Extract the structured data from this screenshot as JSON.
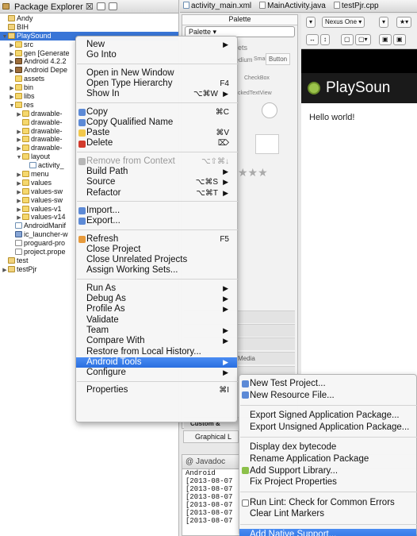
{
  "explorer": {
    "tab_title": "Package Explorer ☒",
    "tree": [
      {
        "label": "Andy",
        "icon": "project-icon",
        "depth": 0,
        "twisty": ""
      },
      {
        "label": "BIH",
        "icon": "project-icon",
        "depth": 0,
        "twisty": ""
      },
      {
        "label": "PlaySound",
        "icon": "project-icon",
        "depth": 0,
        "twisty": "▼"
      },
      {
        "label": "src",
        "icon": "folder-icon",
        "depth": 1,
        "twisty": "▶"
      },
      {
        "label": "gen [Generate",
        "icon": "folder-icon",
        "depth": 1,
        "twisty": "▶"
      },
      {
        "label": "Android 4.2.2",
        "icon": "library-icon",
        "depth": 1,
        "twisty": "▶"
      },
      {
        "label": "Android Depe",
        "icon": "library-icon",
        "depth": 1,
        "twisty": "▶"
      },
      {
        "label": "assets",
        "icon": "folder-icon",
        "depth": 1,
        "twisty": ""
      },
      {
        "label": "bin",
        "icon": "folder-icon",
        "depth": 1,
        "twisty": "▶"
      },
      {
        "label": "libs",
        "icon": "folder-icon",
        "depth": 1,
        "twisty": "▶"
      },
      {
        "label": "res",
        "icon": "folder-icon",
        "depth": 1,
        "twisty": "▼"
      },
      {
        "label": "drawable-",
        "icon": "folder-icon",
        "depth": 2,
        "twisty": "▶"
      },
      {
        "label": "drawable-",
        "icon": "folder-icon",
        "depth": 2,
        "twisty": ""
      },
      {
        "label": "drawable-",
        "icon": "folder-icon",
        "depth": 2,
        "twisty": "▶"
      },
      {
        "label": "drawable-",
        "icon": "folder-icon",
        "depth": 2,
        "twisty": "▶"
      },
      {
        "label": "drawable-",
        "icon": "folder-icon",
        "depth": 2,
        "twisty": "▶"
      },
      {
        "label": "layout",
        "icon": "folder-icon",
        "depth": 2,
        "twisty": "▼"
      },
      {
        "label": "activity_",
        "icon": "xml-file-icon",
        "depth": 3,
        "twisty": ""
      },
      {
        "label": "menu",
        "icon": "folder-icon",
        "depth": 2,
        "twisty": "▶"
      },
      {
        "label": "values",
        "icon": "folder-icon",
        "depth": 2,
        "twisty": "▶"
      },
      {
        "label": "values-sw",
        "icon": "folder-icon",
        "depth": 2,
        "twisty": "▶"
      },
      {
        "label": "values-sw",
        "icon": "folder-icon",
        "depth": 2,
        "twisty": "▶"
      },
      {
        "label": "values-v1",
        "icon": "folder-icon",
        "depth": 2,
        "twisty": "▶"
      },
      {
        "label": "values-v14",
        "icon": "folder-icon",
        "depth": 2,
        "twisty": "▶"
      },
      {
        "label": "AndroidManif",
        "icon": "xml-file-icon",
        "depth": 1,
        "twisty": ""
      },
      {
        "label": "ic_launcher-w",
        "icon": "image-file-icon",
        "depth": 1,
        "twisty": ""
      },
      {
        "label": "proguard-pro",
        "icon": "file-icon",
        "depth": 1,
        "twisty": ""
      },
      {
        "label": "project.prope",
        "icon": "file-icon",
        "depth": 1,
        "twisty": ""
      },
      {
        "label": "test",
        "icon": "project-icon",
        "depth": 0,
        "twisty": ""
      },
      {
        "label": "testPjr",
        "icon": "project-icon",
        "depth": 0,
        "twisty": "▶"
      }
    ]
  },
  "editor_tabs": [
    {
      "label": "activity_main.xml"
    },
    {
      "label": "MainActivity.java"
    },
    {
      "label": "testPjr.cpp"
    }
  ],
  "palette": {
    "header": "Palette",
    "dropdown": "Palette",
    "faded_items": [
      "ets",
      "Medium",
      "Small",
      "Button",
      "CheckBox",
      "ckedTextView",
      "Custom &",
      "Media",
      "Graphical L"
    ]
  },
  "canvas": {
    "device_dropdown": "Nexus One",
    "app_title": "PlaySoun",
    "hello_text": "Hello world!"
  },
  "bottom_panel": {
    "tab": "Javadoc",
    "console": [
      "Android",
      "[2013-08-07",
      "[2013-08-07",
      "[2013-08-07",
      "[2013-08-07",
      "[2013-08-07",
      "[2013-08-07"
    ]
  },
  "context_menu": [
    {
      "label": "New",
      "shortcut": "",
      "submenu": true,
      "icon": ""
    },
    {
      "label": "Go Into",
      "shortcut": "",
      "submenu": false,
      "icon": ""
    },
    {
      "separator": true
    },
    {
      "label": "Open in New Window",
      "shortcut": "",
      "submenu": false,
      "icon": ""
    },
    {
      "label": "Open Type Hierarchy",
      "shortcut": "F4",
      "submenu": false,
      "icon": ""
    },
    {
      "label": "Show In",
      "shortcut": "⌥⌘W",
      "submenu": true,
      "icon": ""
    },
    {
      "separator": true
    },
    {
      "label": "Copy",
      "shortcut": "⌘C",
      "submenu": false,
      "icon": "copy-icon"
    },
    {
      "label": "Copy Qualified Name",
      "shortcut": "",
      "submenu": false,
      "icon": "copy-icon"
    },
    {
      "label": "Paste",
      "shortcut": "⌘V",
      "submenu": false,
      "icon": "paste-icon"
    },
    {
      "label": "Delete",
      "shortcut": "⌦",
      "submenu": false,
      "icon": "delete-icon"
    },
    {
      "separator": true
    },
    {
      "label": "Remove from Context",
      "shortcut": "⌥⇧⌘↓",
      "submenu": false,
      "icon": "remove-context-icon",
      "disabled": true
    },
    {
      "label": "Build Path",
      "shortcut": "",
      "submenu": true,
      "icon": ""
    },
    {
      "label": "Source",
      "shortcut": "⌥⌘S",
      "submenu": true,
      "icon": ""
    },
    {
      "label": "Refactor",
      "shortcut": "⌥⌘T",
      "submenu": true,
      "icon": ""
    },
    {
      "separator": true
    },
    {
      "label": "Import...",
      "shortcut": "",
      "submenu": false,
      "icon": "import-icon"
    },
    {
      "label": "Export...",
      "shortcut": "",
      "submenu": false,
      "icon": "export-icon"
    },
    {
      "separator": true
    },
    {
      "label": "Refresh",
      "shortcut": "F5",
      "submenu": false,
      "icon": "refresh-icon"
    },
    {
      "label": "Close Project",
      "shortcut": "",
      "submenu": false,
      "icon": ""
    },
    {
      "label": "Close Unrelated Projects",
      "shortcut": "",
      "submenu": false,
      "icon": ""
    },
    {
      "label": "Assign Working Sets...",
      "shortcut": "",
      "submenu": false,
      "icon": ""
    },
    {
      "separator": true
    },
    {
      "label": "Run As",
      "shortcut": "",
      "submenu": true,
      "icon": ""
    },
    {
      "label": "Debug As",
      "shortcut": "",
      "submenu": true,
      "icon": ""
    },
    {
      "label": "Profile As",
      "shortcut": "",
      "submenu": true,
      "icon": ""
    },
    {
      "label": "Validate",
      "shortcut": "",
      "submenu": false,
      "icon": ""
    },
    {
      "label": "Team",
      "shortcut": "",
      "submenu": true,
      "icon": ""
    },
    {
      "label": "Compare With",
      "shortcut": "",
      "submenu": true,
      "icon": ""
    },
    {
      "label": "Restore from Local History...",
      "shortcut": "",
      "submenu": false,
      "icon": ""
    },
    {
      "label": "Android Tools",
      "shortcut": "",
      "submenu": true,
      "icon": "",
      "highlighted": true
    },
    {
      "label": "Configure",
      "shortcut": "",
      "submenu": true,
      "icon": ""
    },
    {
      "separator": true
    },
    {
      "label": "Properties",
      "shortcut": "⌘I",
      "submenu": false,
      "icon": ""
    }
  ],
  "android_tools_submenu": [
    {
      "label": "New Test Project...",
      "icon": "new-test-project-icon"
    },
    {
      "label": "New Resource File...",
      "icon": "new-resource-file-icon"
    },
    {
      "separator": true
    },
    {
      "label": "Export Signed Application Package...",
      "icon": ""
    },
    {
      "label": "Export Unsigned Application Package...",
      "icon": ""
    },
    {
      "separator": true
    },
    {
      "label": "Display dex bytecode",
      "icon": ""
    },
    {
      "label": "Rename Application Package",
      "icon": ""
    },
    {
      "label": "Add Support Library...",
      "icon": "android-icon"
    },
    {
      "label": "Fix Project Properties",
      "icon": ""
    },
    {
      "separator": true
    },
    {
      "label": "Run Lint: Check for Common Errors",
      "icon": "lint-check-icon"
    },
    {
      "label": "Clear Lint Markers",
      "icon": ""
    },
    {
      "separator": true
    },
    {
      "label": "Add Native Support...",
      "icon": "",
      "highlighted": true
    }
  ],
  "colors": {
    "selection": "#3875d7",
    "menu_highlight": "#2a6fe0",
    "android_green": "#9bc34b"
  }
}
